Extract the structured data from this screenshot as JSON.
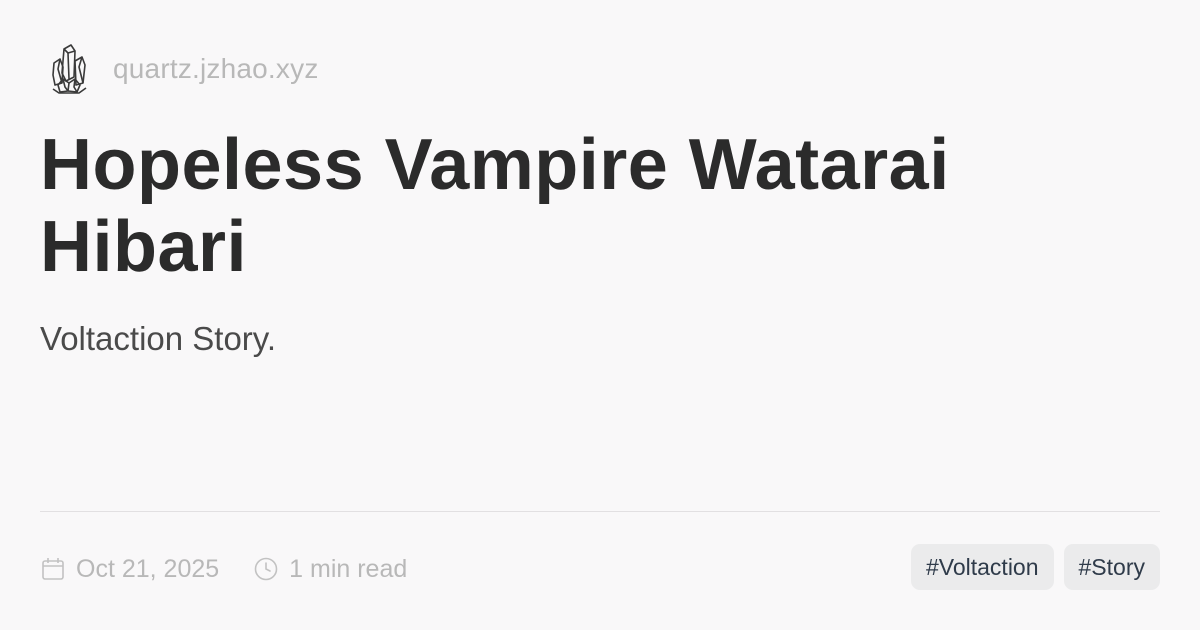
{
  "site": {
    "logo_icon": "crystal-icon",
    "url": "quartz.jzhao.xyz"
  },
  "page": {
    "title": "Hopeless Vampire Watarai Hibari",
    "description": "Voltaction Story."
  },
  "meta": {
    "date_icon": "calendar-icon",
    "date": "Oct 21, 2025",
    "reading_icon": "clock-icon",
    "reading_time": "1 min read"
  },
  "tags": [
    {
      "label": "#Voltaction"
    },
    {
      "label": "#Story"
    }
  ],
  "colors": {
    "background": "#f9f8f9",
    "title": "#2b2b2b",
    "muted": "#b8b8b8",
    "tag_background": "#ebebec",
    "tag_text": "#2f3b4a"
  }
}
